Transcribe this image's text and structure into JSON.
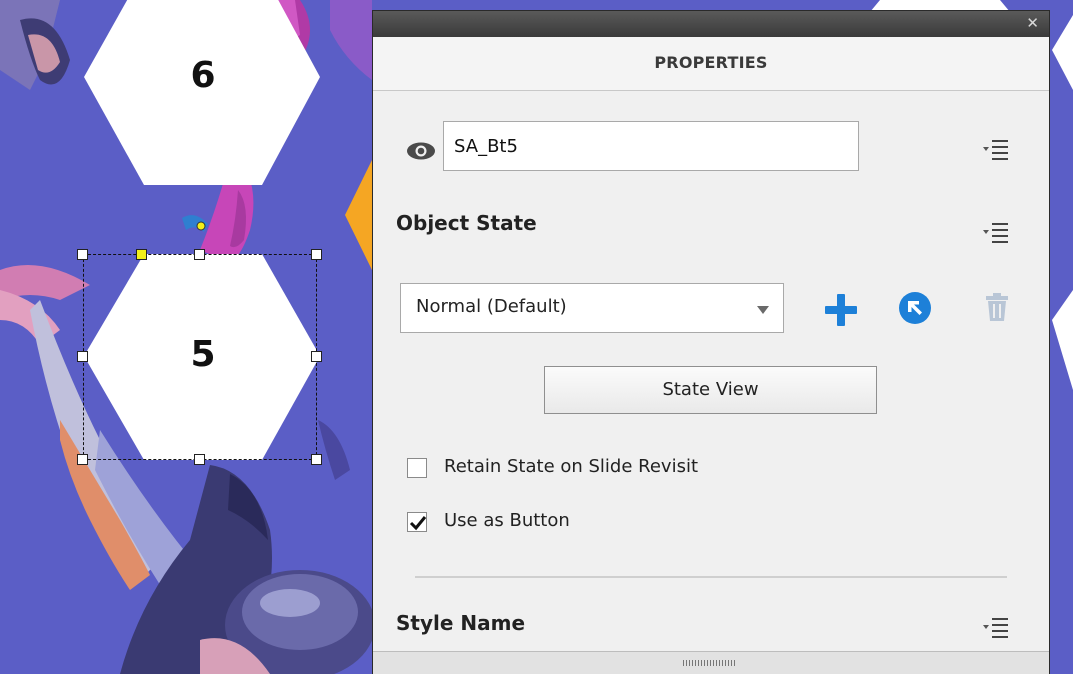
{
  "stage": {
    "hexagons": [
      {
        "label": "6"
      },
      {
        "label": "5"
      }
    ]
  },
  "panel": {
    "title": "PROPERTIES",
    "close_icon": "close-icon",
    "object_name": "SA_Bt5",
    "object_state_title": "Object State",
    "state_dropdown_value": "Normal (Default)",
    "state_view_label": "State View",
    "retain_state_label": "Retain State on Slide Revisit",
    "retain_state_checked": false,
    "use_as_button_label": "Use as Button",
    "use_as_button_checked": true,
    "style_name_title": "Style Name",
    "colors": {
      "accent_blue": "#1d80d8",
      "stage_purple": "#5b5ec6",
      "orange_arrow": "#f5a623"
    }
  }
}
